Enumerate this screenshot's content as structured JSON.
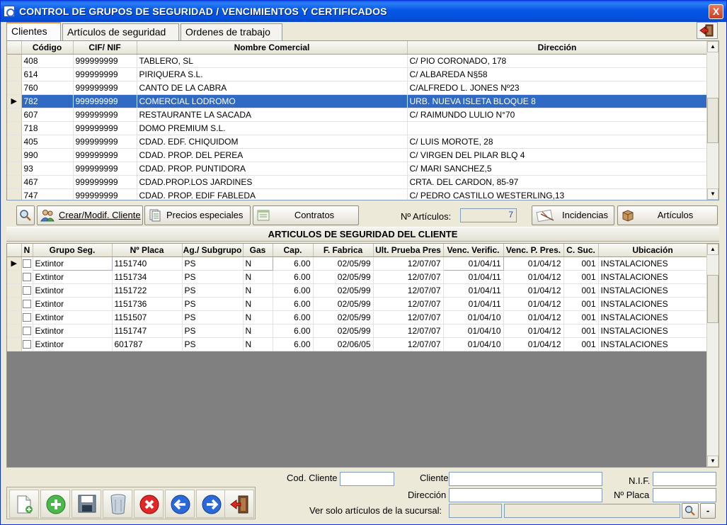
{
  "window": {
    "title": "CONTROL DE GRUPOS DE SEGURIDAD / VENCIMIENTOS Y CERTIFICADOS",
    "close_label": "X"
  },
  "tabs": [
    {
      "label": "Clientes"
    },
    {
      "label": "Artículos de seguridad"
    },
    {
      "label": "Ordenes de trabajo"
    }
  ],
  "clients_grid": {
    "columns": [
      "Código",
      "CIF/ NIF",
      "Nombre Comercial",
      "Dirección"
    ],
    "rows": [
      [
        "408",
        "999999999",
        "TABLERO, SL",
        "C/ PIO CORONADO, 178"
      ],
      [
        "614",
        "999999999",
        "PIRIQUERA S.L.",
        "C/ ALBAREDA N§58"
      ],
      [
        "760",
        "999999999",
        "CANTO DE LA CABRA",
        "C/ALFREDO L. JONES Nº23"
      ],
      [
        "782",
        "999999999",
        "COMERCIAL LODROMO",
        "URB. NUEVA ISLETA BLOQUE 8"
      ],
      [
        "607",
        "999999999",
        "RESTAURANTE LA SACADA",
        "C/ RAIMUNDO LULIO N°70"
      ],
      [
        "718",
        "999999999",
        "DOMO PREMIUM  S.L.",
        ""
      ],
      [
        "405",
        "999999999",
        "CDAD. EDF. CHIQUIDOM",
        "C/ LUIS MOROTE, 28"
      ],
      [
        "990",
        "999999999",
        "CDAD. PROP. DEL PEREA",
        "C/ VIRGEN DEL PILAR BLQ 4"
      ],
      [
        "93",
        "999999999",
        "CDAD. PROP. PUNTIDORA",
        "C/ MARI SANCHEZ,5"
      ],
      [
        "467",
        "999999999",
        "CDAD.PROP.LOS JARDINES",
        "CRTA. DEL CARDON, 85-97"
      ],
      [
        "747",
        "999999999",
        "CDAD. PROP. EDIF FABLEDA",
        "C/ PEDRO CASTILLO WESTERLING,13"
      ]
    ],
    "selected_index": 3,
    "pointer": "▶"
  },
  "toolbar": {
    "crear_label": "Crear/Modif. Cliente",
    "precios_label": "Precios especiales",
    "contratos_label": "Contratos",
    "num_articulos_label": "Nº Artículos:",
    "num_articulos_value": "7",
    "incidencias_label": "Incidencias",
    "articulos_label": "Artículos"
  },
  "section_title": "ARTICULOS DE SEGURIDAD DEL CLIENTE",
  "articles_grid": {
    "columns": [
      "N",
      "Grupo Seg.",
      "Nº Placa",
      "Ag./ Subgrupo",
      "Gas",
      "Cap.",
      "F. Fabrica",
      "Ult. Prueba Pres",
      "Venc. Verific.",
      "Venc. P. Pres.",
      "C. Suc.",
      "Ubicación"
    ],
    "rows": [
      [
        "Extintor",
        "1151740",
        "PS",
        "N",
        "6.00",
        "02/05/99",
        "12/07/07",
        "01/04/11",
        "01/04/12",
        "001",
        "INSTALACIONES"
      ],
      [
        "Extintor",
        "1151734",
        "PS",
        "N",
        "6.00",
        "02/05/99",
        "12/07/07",
        "01/04/11",
        "01/04/12",
        "001",
        "INSTALACIONES"
      ],
      [
        "Extintor",
        "1151722",
        "PS",
        "N",
        "6.00",
        "02/05/99",
        "12/07/07",
        "01/04/11",
        "01/04/12",
        "001",
        "INSTALACIONES"
      ],
      [
        "Extintor",
        "1151736",
        "PS",
        "N",
        "6.00",
        "02/05/99",
        "12/07/07",
        "01/04/11",
        "01/04/12",
        "001",
        "INSTALACIONES"
      ],
      [
        "Extintor",
        "1151507",
        "PS",
        "N",
        "6.00",
        "02/05/99",
        "12/07/07",
        "01/04/10",
        "01/04/12",
        "001",
        "INSTALACIONES"
      ],
      [
        "Extintor",
        "1151747",
        "PS",
        "N",
        "6.00",
        "02/05/99",
        "12/07/07",
        "01/04/10",
        "01/04/12",
        "001",
        "INSTALACIONES"
      ],
      [
        "Extintor",
        "601787",
        "PS",
        "N",
        "6.00",
        "02/06/05",
        "12/07/07",
        "01/04/10",
        "01/04/12",
        "001",
        "INSTALACIONES"
      ]
    ],
    "pointer": "▶"
  },
  "filters": {
    "cod_cliente_label": "Cod. Cliente",
    "cliente_label": "Cliente",
    "nif_label": "N.I.F.",
    "direccion_label": "Dirección",
    "placa_label": "Nº Placa",
    "sucursal_label": "Ver solo artículos de la sucursal:",
    "minus_label": "-"
  },
  "bottom_toolbar": [
    {
      "name": "new-document-icon"
    },
    {
      "name": "add-icon"
    },
    {
      "name": "save-icon"
    },
    {
      "name": "delete-icon"
    },
    {
      "name": "cancel-icon"
    },
    {
      "name": "previous-icon"
    },
    {
      "name": "next-icon"
    },
    {
      "name": "exit-icon"
    }
  ],
  "colors": {
    "titlebar": "#0456e4",
    "selection": "#316ac5",
    "accent_tab": "#e68b2c"
  }
}
